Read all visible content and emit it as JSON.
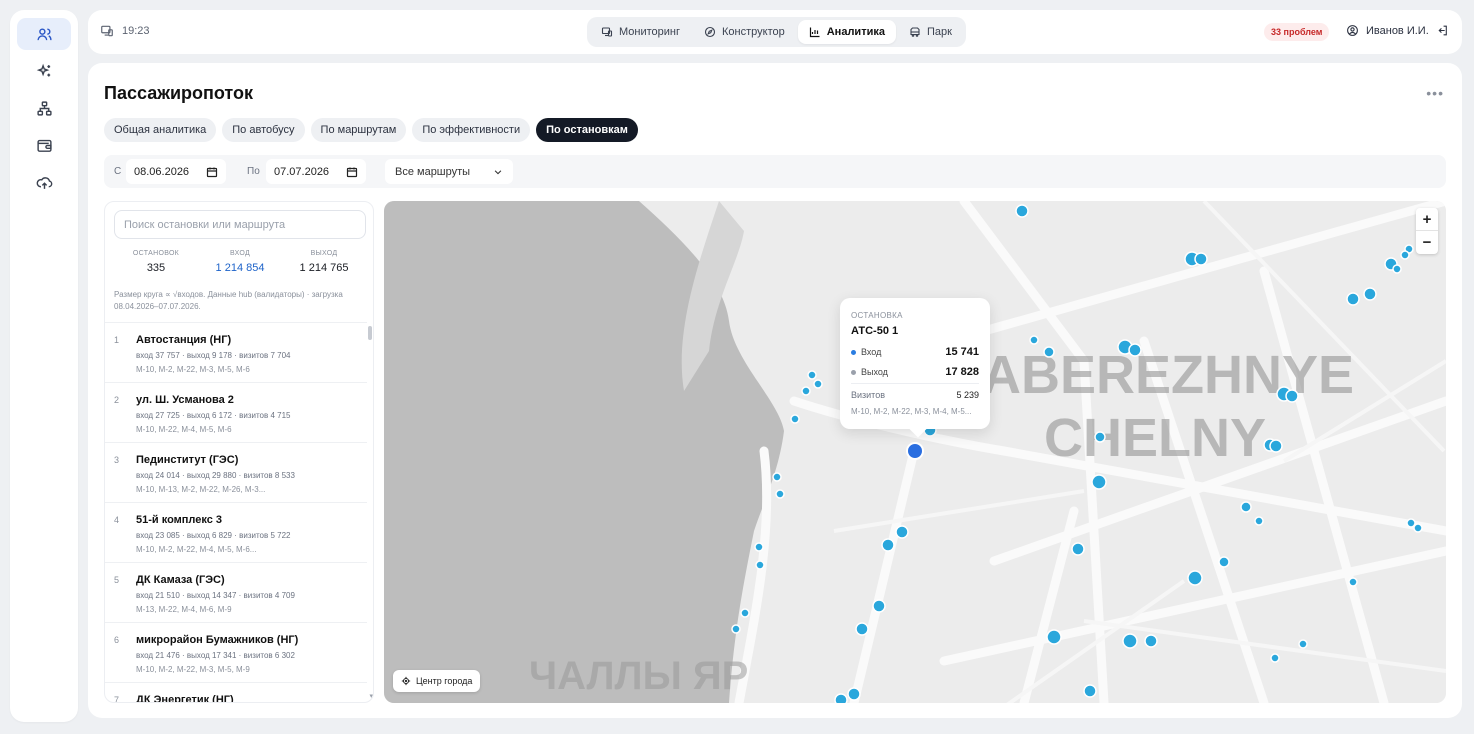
{
  "rail": {
    "items": [
      "users-icon",
      "sparkles-icon",
      "network-icon",
      "wallet-icon",
      "cloud-upload-icon"
    ]
  },
  "topbar": {
    "time": "19:23",
    "tabs": [
      {
        "label": "Мониторинг",
        "icon": "monitor-icon"
      },
      {
        "label": "Конструктор",
        "icon": "compass-icon"
      },
      {
        "label": "Аналитика",
        "icon": "chart-icon"
      },
      {
        "label": "Парк",
        "icon": "bus-icon"
      }
    ],
    "active_tab": "Аналитика",
    "problems": "33 проблем",
    "user": "Иванов И.И."
  },
  "page": {
    "title": "Пассажиропоток",
    "subtabs": [
      "Общая аналитика",
      "По автобусу",
      "По маршрутам",
      "По эффективности",
      "По остановкам"
    ],
    "active_subtab": "По остановкам"
  },
  "filters": {
    "from_label": "С",
    "from_value": "08.06.2026",
    "to_label": "По",
    "to_value": "07.07.2026",
    "routes_value": "Все маршруты"
  },
  "panel": {
    "search_placeholder": "Поиск остановки или маршрута",
    "stats": [
      {
        "label": "ОСТАНОВОК",
        "value": "335"
      },
      {
        "label": "ВХОД",
        "value": "1 214 854"
      },
      {
        "label": "ВЫХОД",
        "value": "1 214 765"
      }
    ],
    "note": "Размер круга ∝ √входов. Данные hub (валидаторы) · загрузка 08.04.2026–07.07.2026.",
    "stops": [
      {
        "num": "1",
        "name": "Автостанция (НГ)",
        "meta": "вход 37 757 · выход 9 178 · визитов 7 704",
        "routes": "М-10, М-2, М-22, М-3, М-5, М-6"
      },
      {
        "num": "2",
        "name": "ул. Ш. Усманова 2",
        "meta": "вход 27 725 · выход 6 172 · визитов 4 715",
        "routes": "М-10, М-22, М-4, М-5, М-6"
      },
      {
        "num": "3",
        "name": "Пединститут (ГЭС)",
        "meta": "вход 24 014 · выход 29 880 · визитов 8 533",
        "routes": "М-10, М-13, М-2, М-22, М-26, М-3..."
      },
      {
        "num": "4",
        "name": "51-й комплекс 3",
        "meta": "вход 23 085 · выход 6 829 · визитов 5 722",
        "routes": "М-10, М-2, М-22, М-4, М-5, М-6..."
      },
      {
        "num": "5",
        "name": "ДК Камаза (ГЭС)",
        "meta": "вход 21 510 · выход 14 347 · визитов 4 709",
        "routes": "М-13, М-22, М-4, М-6, М-9"
      },
      {
        "num": "6",
        "name": "микрорайон Бумажников (НГ)",
        "meta": "вход 21 476 · выход 17 341 · визитов 6 302",
        "routes": "М-10, М-2, М-22, М-3, М-5, М-9"
      },
      {
        "num": "7",
        "name": "ДК Энергетик (НГ)",
        "meta": "",
        "routes": ""
      }
    ]
  },
  "map": {
    "city_label": "ABEREZHNYE CHELNY",
    "district_label": "ЧАЛЛЫ ЯР",
    "zoom_in": "+",
    "zoom_out": "−",
    "center_button": "Центр города",
    "tooltip": {
      "label": "ОСТАНОВКА",
      "name": "АТС-50 1",
      "in_label": "Вход",
      "in_value": "15 741",
      "out_label": "Выход",
      "out_value": "17 828",
      "visits_label": "Визитов",
      "visits_value": "5 239",
      "routes": "М-10, М-2, М-22, М-3, М-4, М-5..."
    },
    "colors": {
      "stop": "#2aa7dc",
      "selected": "#2a6ee0",
      "water": "#b9b9b9",
      "land": "#ececec"
    }
  }
}
